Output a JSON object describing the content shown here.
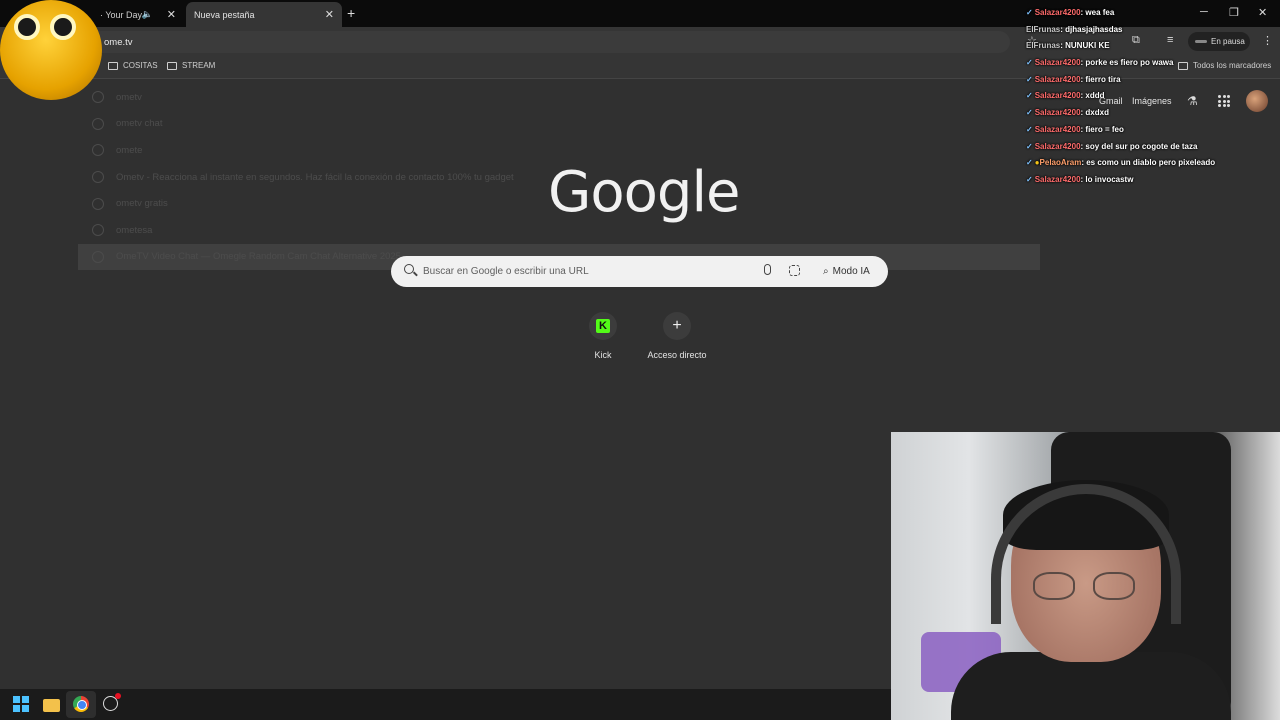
{
  "browser": {
    "tabs": [
      {
        "title": "· Your Day",
        "active": false
      },
      {
        "title": "Nueva pestaña",
        "active": true
      }
    ],
    "omnibox_value": "ome.tv",
    "paused_label": "En pausa",
    "bookmarks": [
      "COSITAS",
      "STREAM"
    ],
    "all_bookmarks_label": "Todos los marcadores",
    "suggestions": [
      "ometv",
      "ometv chat",
      "omete",
      "Ometv - Reacciona al instante en segundos. Haz fácil la conexión de contacto 100% tu gadget",
      "ometv gratis",
      "ometesa",
      "OmeTV Video Chat — Omegle Random Cam Chat Alternative 2025"
    ]
  },
  "google": {
    "logo": "Google",
    "gmail": "Gmail",
    "images": "Imágenes",
    "search_placeholder": "Buscar en Google o escribir una URL",
    "ai_mode": "Modo IA",
    "shortcuts": [
      {
        "label": "Kick",
        "icon": "kick-icon"
      },
      {
        "label": "Acceso directo",
        "icon": "plus-icon"
      }
    ]
  },
  "chat": [
    {
      "user": "Salazar4200",
      "text": "wea fea",
      "color": "#ff6b6b"
    },
    {
      "user": "ElFrunas",
      "text": "djhasjajhasdas",
      "color": "#c9c9c9"
    },
    {
      "user": "ElFrunas",
      "text": "NUNUKI KE",
      "color": "#c9c9c9"
    },
    {
      "user": "Salazar4200",
      "text": "porke es fiero po wawa",
      "color": "#ff6b6b"
    },
    {
      "user": "Salazar4200",
      "text": "fierro tira",
      "color": "#ff6b6b"
    },
    {
      "user": "Salazar4200",
      "text": "xddd",
      "color": "#ff6b6b"
    },
    {
      "user": "Salazar4200",
      "text": "dxdxd",
      "color": "#ff6b6b"
    },
    {
      "user": "Salazar4200",
      "text": "fiero = feo",
      "color": "#ff6b6b"
    },
    {
      "user": "Salazar4200",
      "text": "soy del sur po cogote de taza",
      "color": "#ff6b6b"
    },
    {
      "user": "PelaoAram",
      "text": "es como un diablo pero pixeleado",
      "color": "#ff9f6b"
    },
    {
      "user": "Salazar4200",
      "text": "lo invocastw",
      "color": "#ff6b6b"
    }
  ]
}
